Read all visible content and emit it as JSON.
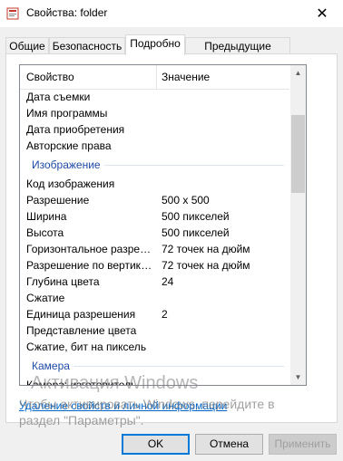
{
  "window": {
    "title": "Свойства: folder",
    "close_glyph": "✕"
  },
  "tabs": [
    {
      "label": "Общие"
    },
    {
      "label": "Безопасность"
    },
    {
      "label": "Подробно"
    },
    {
      "label": "Предыдущие версии"
    }
  ],
  "list": {
    "col_property": "Свойство",
    "col_value": "Значение",
    "rows": [
      {
        "name": "Дата съемки",
        "value": ""
      },
      {
        "name": "Имя программы",
        "value": ""
      },
      {
        "name": "Дата приобретения",
        "value": ""
      },
      {
        "name": "Авторские права",
        "value": ""
      }
    ],
    "group_image": "Изображение",
    "image_rows": [
      {
        "name": "Код изображения",
        "value": ""
      },
      {
        "name": "Разрешение",
        "value": "500 x 500"
      },
      {
        "name": "Ширина",
        "value": "500 пикселей"
      },
      {
        "name": "Высота",
        "value": "500 пикселей"
      },
      {
        "name": "Горизонтальное разрешение",
        "value": "72 точек на дюйм"
      },
      {
        "name": "Разрешение по вертикали",
        "value": "72 точек на дюйм"
      },
      {
        "name": "Глубина цвета",
        "value": "24"
      },
      {
        "name": "Сжатие",
        "value": ""
      },
      {
        "name": "Единица разрешения",
        "value": "2"
      },
      {
        "name": "Представление цвета",
        "value": ""
      },
      {
        "name": "Сжатие, бит на пиксель",
        "value": ""
      }
    ],
    "group_camera": "Камера",
    "camera_rows": [
      {
        "name": "Камера: изготовитель",
        "value": ""
      }
    ]
  },
  "link_remove": "Удаление свойств и личной информации",
  "watermark": {
    "line1": "Активация Windows",
    "line2": "Чтобы активировать Windows, перейдите в раздел \"Параметры\"."
  },
  "buttons": {
    "ok": "OK",
    "cancel": "Отмена",
    "apply": "Применить"
  }
}
